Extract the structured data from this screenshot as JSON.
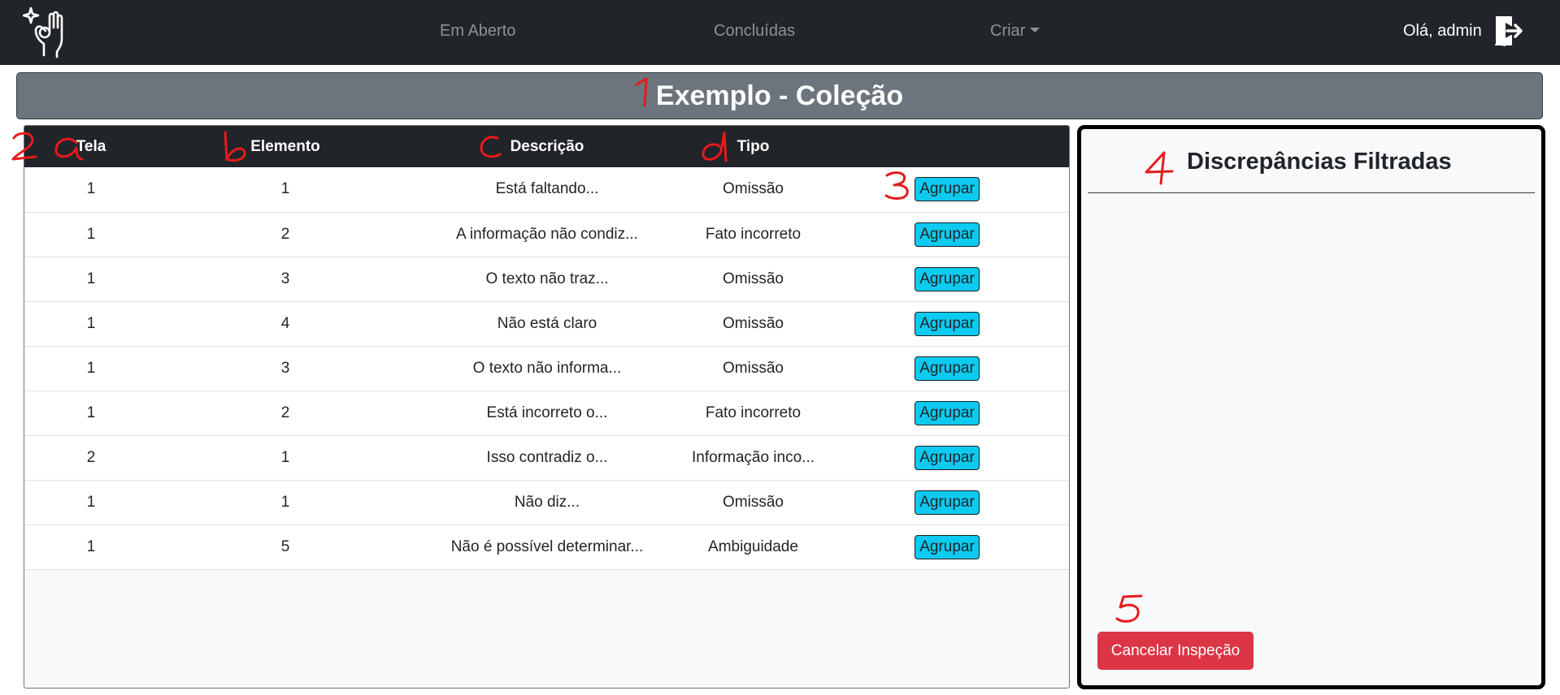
{
  "navbar": {
    "links": [
      {
        "label": "Em Aberto"
      },
      {
        "label": "Concluídas"
      },
      {
        "label": "Criar"
      }
    ],
    "greeting": "Olá, admin",
    "logo_icon": "ok-hand-sparkle-icon",
    "logout_icon": "logout-icon"
  },
  "title": "Exemplo - Coleção",
  "table": {
    "headers": [
      "Tela",
      "Elemento",
      "Descrição",
      "Tipo"
    ],
    "action_label": "Agrupar",
    "rows": [
      {
        "tela": "1",
        "elemento": "1",
        "descricao": "Está faltando...",
        "tipo": "Omissão"
      },
      {
        "tela": "1",
        "elemento": "2",
        "descricao": "A informação não condiz...",
        "tipo": "Fato incorreto"
      },
      {
        "tela": "1",
        "elemento": "3",
        "descricao": "O texto não traz...",
        "tipo": "Omissão"
      },
      {
        "tela": "1",
        "elemento": "4",
        "descricao": "Não está claro",
        "tipo": "Omissão"
      },
      {
        "tela": "1",
        "elemento": "3",
        "descricao": "O texto não informa...",
        "tipo": "Omissão"
      },
      {
        "tela": "1",
        "elemento": "2",
        "descricao": "Está incorreto o...",
        "tipo": "Fato incorreto"
      },
      {
        "tela": "2",
        "elemento": "1",
        "descricao": "Isso contradiz o...",
        "tipo": "Informação inco..."
      },
      {
        "tela": "1",
        "elemento": "1",
        "descricao": "Não diz...",
        "tipo": "Omissão"
      },
      {
        "tela": "1",
        "elemento": "5",
        "descricao": "Não é possível determinar...",
        "tipo": "Ambiguidade"
      }
    ]
  },
  "side_panel": {
    "title": "Discrepâncias Filtradas",
    "cancel_label": "Cancelar Inspeção"
  },
  "annotations": {
    "marks": [
      "1",
      "2",
      "a",
      "b",
      "c",
      "d",
      "3",
      "4",
      "5"
    ],
    "color": "#e8191d"
  },
  "colors": {
    "navbar": "#212529",
    "title_bar": "#6c757d",
    "agrupar": "#0dcaf0",
    "cancel": "#dc3545"
  }
}
